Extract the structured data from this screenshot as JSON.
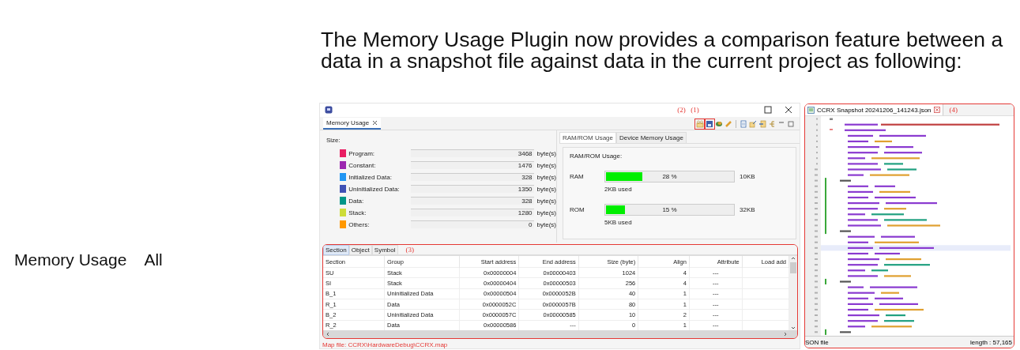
{
  "intro_text": "The Memory Usage Plugin now provides a comparison feature between a data in a snapshot file against data in the current project as following:",
  "side_label": {
    "title": "Memory Usage",
    "value": "All"
  },
  "memory_window": {
    "view_tab": "Memory Usage",
    "callouts": [
      "(2)",
      "(1)"
    ],
    "size_label": "Size:",
    "sizes": [
      {
        "name": "Program:",
        "color": "#e91e63",
        "value": "3468",
        "unit": "byte(s)"
      },
      {
        "name": "Constant:",
        "color": "#9c27b0",
        "value": "1476",
        "unit": "byte(s)"
      },
      {
        "name": "Initialized Data:",
        "color": "#2196f3",
        "value": "328",
        "unit": "byte(s)"
      },
      {
        "name": "Uninitialized Data:",
        "color": "#3f51b5",
        "value": "1350",
        "unit": "byte(s)"
      },
      {
        "name": "Data:",
        "color": "#009688",
        "value": "328",
        "unit": "byte(s)"
      },
      {
        "name": "Stack:",
        "color": "#cddc39",
        "value": "1280",
        "unit": "byte(s)"
      },
      {
        "name": "Others:",
        "color": "#ff9800",
        "value": "0",
        "unit": "byte(s)"
      }
    ],
    "usage_tabs": [
      {
        "label": "RAM/ROM Usage",
        "selected": true
      },
      {
        "label": "Device Memory Usage",
        "selected": false
      }
    ],
    "usage_title": "RAM/ROM Usage:",
    "meters": [
      {
        "name": "RAM",
        "level": 0.28,
        "reading": "28 %",
        "capacity": "10KB",
        "used": "2KB used"
      },
      {
        "name": "ROM",
        "level": 0.15,
        "reading": "15 %",
        "capacity": "32KB",
        "used": "5KB used"
      }
    ],
    "table_tabs": [
      {
        "label": "Section",
        "selected": true
      },
      {
        "label": "Object",
        "selected": false
      },
      {
        "label": "Symbol",
        "selected": false
      }
    ],
    "table_callout": "(3)",
    "table": {
      "columns": [
        "Section",
        "Group",
        "Start address",
        "End address",
        "Size (byte)",
        "Align",
        "Attribute",
        "Load add"
      ],
      "rows": [
        [
          "SU",
          "Stack",
          "0x00000004",
          "0x00000403",
          "1024",
          "4",
          "---",
          ""
        ],
        [
          "SI",
          "Stack",
          "0x00000404",
          "0x00000503",
          "256",
          "4",
          "---",
          ""
        ],
        [
          "B_1",
          "Uninitialized Data",
          "0x00000504",
          "0x0000052B",
          "40",
          "1",
          "---",
          ""
        ],
        [
          "R_1",
          "Data",
          "0x0000052C",
          "0x0000057B",
          "80",
          "1",
          "---",
          ""
        ],
        [
          "B_2",
          "Uninitialized Data",
          "0x0000057C",
          "0x00000585",
          "10",
          "2",
          "---",
          ""
        ],
        [
          "R_2",
          "Data",
          "0x00000586",
          "---",
          "0",
          "1",
          "---",
          ""
        ]
      ]
    },
    "map_file": "Map file: CCRX\\HardwareDebug\\CCRX.map"
  },
  "json_editor": {
    "tab_title": "CCRX Snapshot 20241206_141243.json",
    "callout": "(4)",
    "status": "SON file",
    "length": "length : 57,165"
  }
}
